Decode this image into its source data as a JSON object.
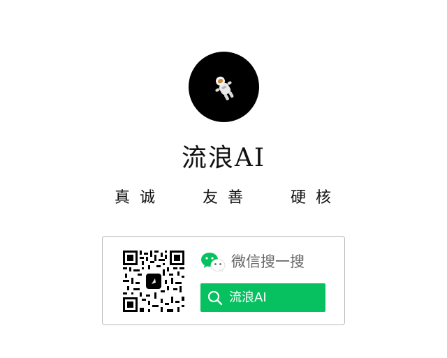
{
  "profile": {
    "avatar_icon": "astronaut-icon",
    "name": "流浪AI",
    "taglines": [
      "真诚",
      "友善",
      "硬核"
    ]
  },
  "wechat_card": {
    "qr_icon": "qr-code-icon",
    "wechat_icon": "wechat-logo-icon",
    "search_prompt": "微信搜一搜",
    "search_icon": "search-icon",
    "search_term": "流浪AI"
  },
  "colors": {
    "avatar_bg": "#000000",
    "wechat_green": "#07c160",
    "text_dark": "#111111",
    "text_muted": "#666666",
    "card_border": "#b9b9b9"
  }
}
